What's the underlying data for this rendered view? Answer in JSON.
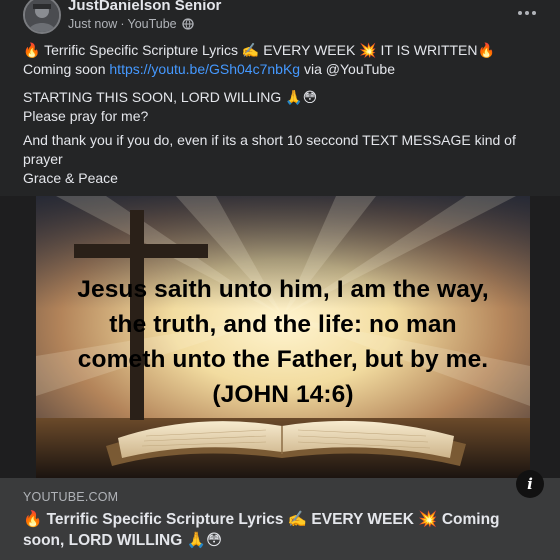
{
  "post": {
    "author": "JustDanielson Senior",
    "timestamp": "Just now",
    "separator": "·",
    "source": "YouTube",
    "lines": {
      "l1_a": "🔥 Terrific Specific Scripture Lyrics ✍️ EVERY WEEK 💥 IT IS WRITTEN🔥  Coming soon ",
      "l1_link": "https://youtu.be/GSh04c7nbKg",
      "l1_b": " via @YouTube",
      "l2": "STARTING THIS SOON, LORD WILLING 🙏😳",
      "l3": "Please pray for me?",
      "l4": "And thank you if you do, even if its a short 10 seccond TEXT MESSAGE kind of prayer",
      "l5": "Grace & Peace"
    }
  },
  "preview": {
    "verse_lines": [
      "Jesus saith unto him, I am the way,",
      "the truth, and the life: no man",
      "cometh unto the Father, but by me.",
      "(JOHN 14:6)"
    ],
    "info_label": "i",
    "domain": "YOUTUBE.COM",
    "title": "🔥 Terrific Specific Scripture Lyrics ✍️ EVERY WEEK 💥 Coming soon, LORD WILLING 🙏😳"
  },
  "icons": {
    "avatar": "profile-avatar",
    "globe": "globe-icon",
    "more": "more-options-icon",
    "info": "info-icon"
  },
  "colors": {
    "background": "#242526",
    "text": "#e4e6eb",
    "secondary_text": "#b0b3b8",
    "link": "#4599ff"
  }
}
